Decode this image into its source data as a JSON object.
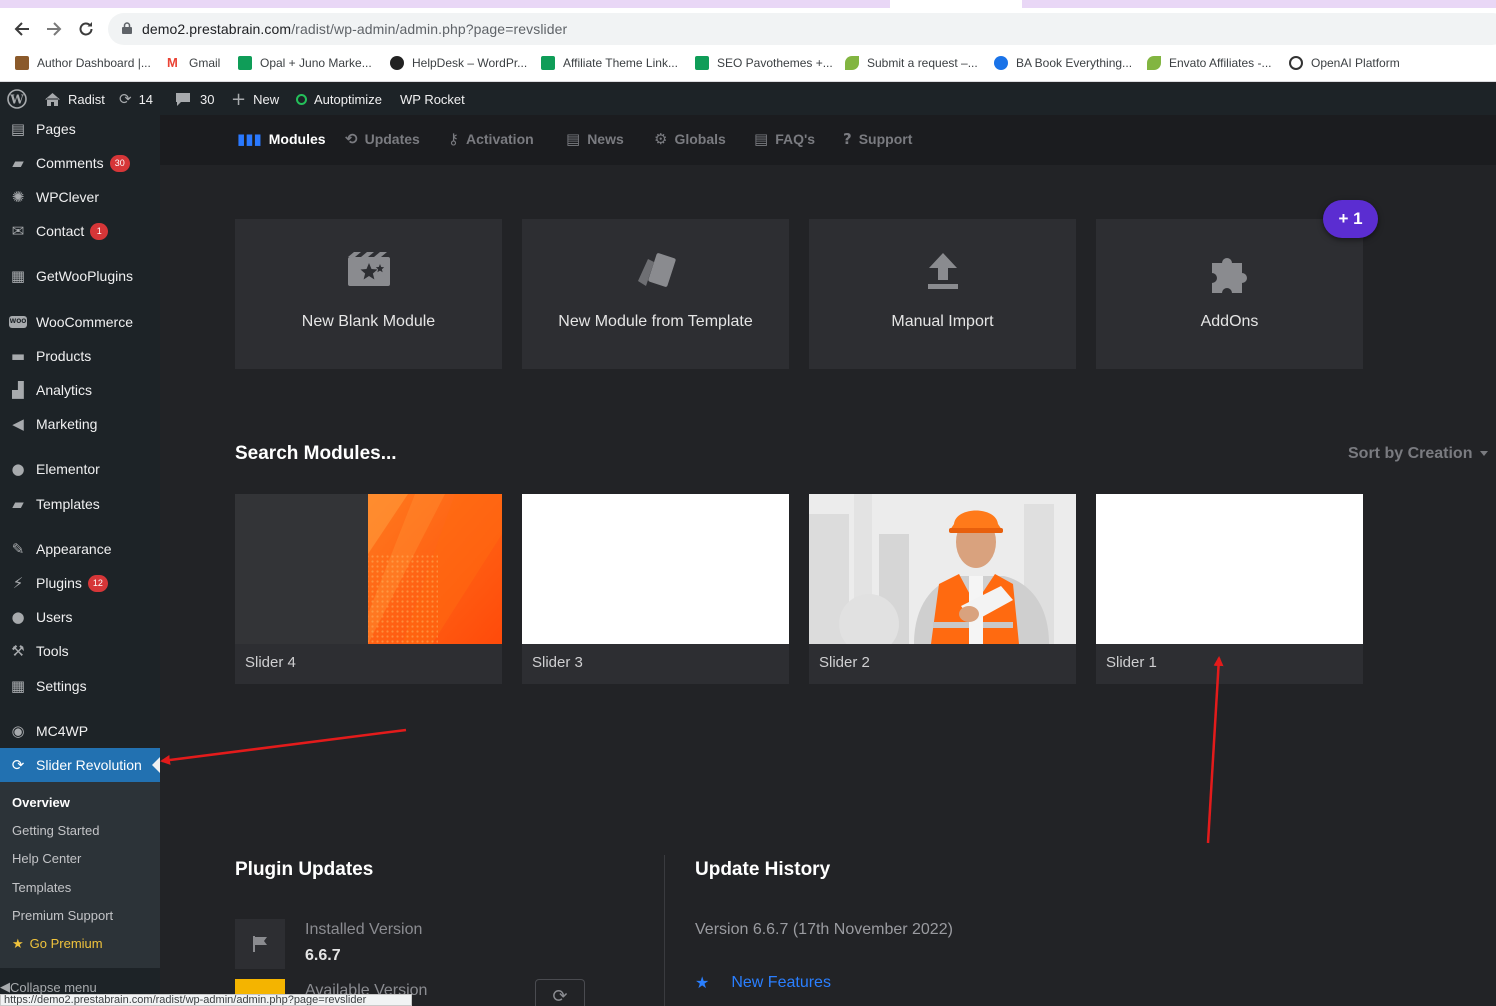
{
  "browser": {
    "url_host": "demo2.prestabrain.com",
    "url_path": "/radist/wp-admin/admin.php?page=revslider",
    "back_icon": "arrow-left-icon",
    "forward_icon": "arrow-right-icon",
    "reload_icon": "reload-icon",
    "bookmarks": [
      {
        "label": "Author Dashboard |...",
        "color": "#8b5a2b"
      },
      {
        "label": "Gmail",
        "color": "#ea4335"
      },
      {
        "label": "Opal + Juno Marke...",
        "color": "#0f9d58"
      },
      {
        "label": "HelpDesk – WordPr...",
        "color": "#222222"
      },
      {
        "label": "Affiliate Theme Link...",
        "color": "#0f9d58"
      },
      {
        "label": "SEO Pavothemes +...",
        "color": "#0f9d58"
      },
      {
        "label": "Submit a request –...",
        "color": "#82b541"
      },
      {
        "label": "BA Book Everything...",
        "color": "#1a73e8"
      },
      {
        "label": "Envato Affiliates -...",
        "color": "#82b541"
      },
      {
        "label": "OpenAI Platform",
        "color": "#333333"
      }
    ],
    "status_url": "https://demo2.prestabrain.com/radist/wp-admin/admin.php?page=revslider"
  },
  "adminbar": {
    "site_name": "Radist",
    "updates_count": "14",
    "comments_count": "30",
    "new_label": "New",
    "autoptimize_label": "Autoptimize",
    "wprocket_label": "WP Rocket"
  },
  "sidebar": {
    "items": [
      {
        "label": "Pages",
        "icon": "pages-icon"
      },
      {
        "label": "Comments",
        "icon": "comments-icon",
        "badge": "30"
      },
      {
        "label": "WPClever",
        "icon": "wpclever-icon"
      },
      {
        "label": "Contact",
        "icon": "mail-icon",
        "badge": "1"
      },
      {
        "label": "GetWooPlugins",
        "icon": "plugin-grid-icon"
      },
      {
        "label": "WooCommerce",
        "icon": "woo-icon"
      },
      {
        "label": "Products",
        "icon": "archive-icon"
      },
      {
        "label": "Analytics",
        "icon": "bar-chart-icon"
      },
      {
        "label": "Marketing",
        "icon": "megaphone-icon"
      },
      {
        "label": "Elementor",
        "icon": "elementor-icon"
      },
      {
        "label": "Templates",
        "icon": "folder-icon"
      },
      {
        "label": "Appearance",
        "icon": "brush-icon"
      },
      {
        "label": "Plugins",
        "icon": "plugin-icon",
        "badge": "12"
      },
      {
        "label": "Users",
        "icon": "user-icon"
      },
      {
        "label": "Tools",
        "icon": "wrench-icon"
      },
      {
        "label": "Settings",
        "icon": "settings-icon"
      },
      {
        "label": "MC4WP",
        "icon": "mc4wp-icon"
      },
      {
        "label": "Slider Revolution",
        "icon": "revslider-icon"
      }
    ],
    "submenu": [
      "Overview",
      "Getting Started",
      "Help Center",
      "Templates",
      "Premium Support",
      "Go Premium"
    ],
    "collapse_label": "Collapse menu"
  },
  "topnav": {
    "tabs": [
      "Modules",
      "Updates",
      "Activation",
      "News",
      "Globals",
      "FAQ's",
      "Support"
    ]
  },
  "cards": [
    {
      "label": "New Blank Module",
      "icon": "film-stars-icon"
    },
    {
      "label": "New Module from Template",
      "icon": "cards-icon"
    },
    {
      "label": "Manual Import",
      "icon": "upload-icon"
    },
    {
      "label": "AddOns",
      "icon": "puzzle-icon"
    }
  ],
  "plus_badge": "+ 1",
  "search_title": "Search Modules...",
  "sort_label": "Sort by Creation",
  "sliders": [
    {
      "label": "Slider 4",
      "thumb": "orange-pattern"
    },
    {
      "label": "Slider 3",
      "thumb": "blank"
    },
    {
      "label": "Slider 2",
      "thumb": "worker-photo"
    },
    {
      "label": "Slider 1",
      "thumb": "blank"
    }
  ],
  "plugin_updates": {
    "title": "Plugin Updates",
    "installed_label": "Installed Version",
    "installed_value": "6.6.7",
    "available_label": "Available Version"
  },
  "update_history": {
    "title": "Update History",
    "version_line": "Version 6.6.7 (17th November 2022)",
    "new_features": "New Features"
  },
  "colors": {
    "accent_blue": "#2271b1",
    "plus_badge": "#5b2dd1",
    "annotation_red": "#e31b1b",
    "orange": "#ff6a1a"
  }
}
